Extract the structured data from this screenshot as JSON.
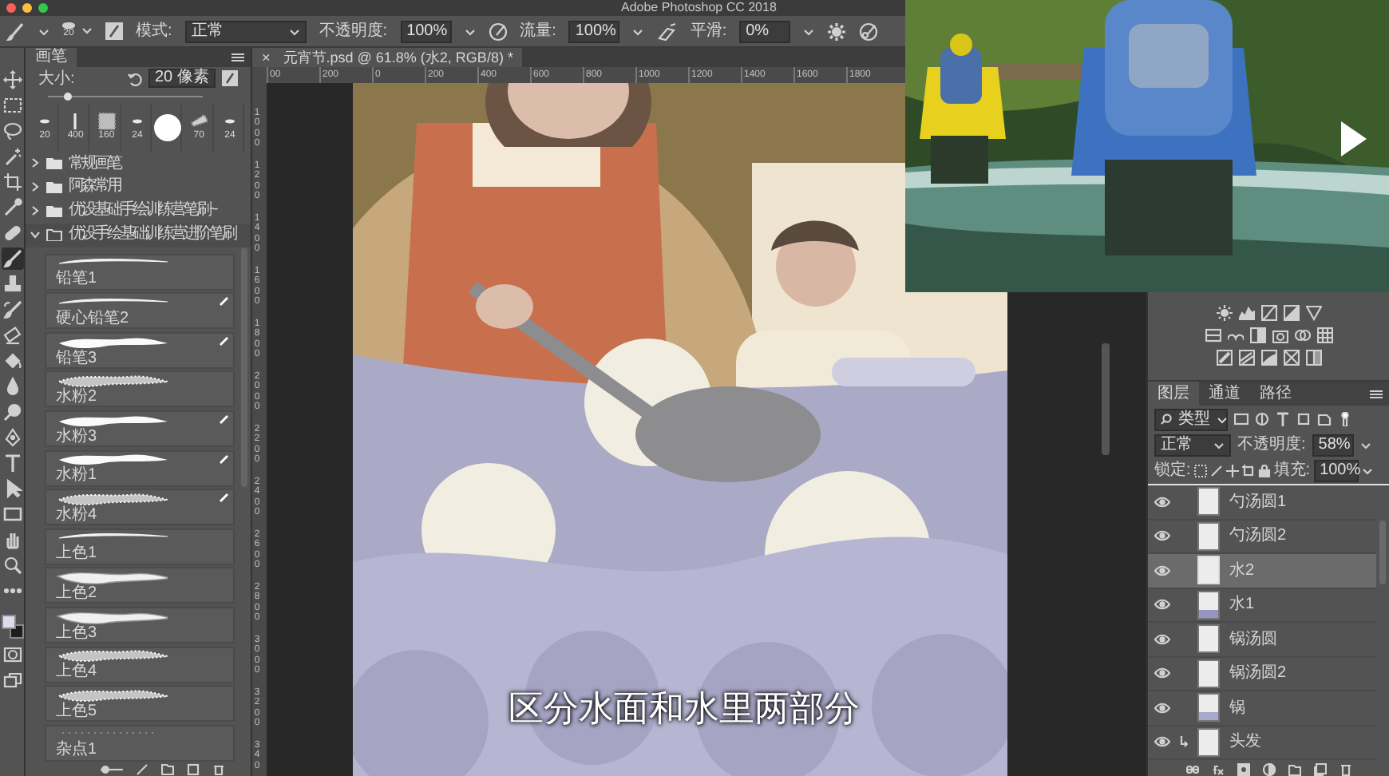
{
  "app": {
    "title": "Adobe Photoshop CC 2018"
  },
  "options_bar": {
    "brush_size": "20",
    "mode_label": "模式:",
    "mode": "正常",
    "opacity_label": "不透明度:",
    "opacity": "100%",
    "flow_label": "流量:",
    "flow": "100%",
    "smoothing_label": "平滑:",
    "smoothing": "0%"
  },
  "tools": [
    {
      "kind": "move",
      "selected": false
    },
    {
      "kind": "marquee",
      "selected": false
    },
    {
      "kind": "lasso",
      "selected": false
    },
    {
      "kind": "wand",
      "selected": false
    },
    {
      "kind": "crop",
      "selected": false
    },
    {
      "kind": "eyedropper",
      "selected": false
    },
    {
      "kind": "healing",
      "selected": false
    },
    {
      "kind": "brush",
      "selected": true
    },
    {
      "kind": "stamp",
      "selected": false
    },
    {
      "kind": "history",
      "selected": false
    },
    {
      "kind": "eraser",
      "selected": false
    },
    {
      "kind": "bucket",
      "selected": false
    },
    {
      "kind": "blur",
      "selected": false
    },
    {
      "kind": "dodge",
      "selected": false
    },
    {
      "kind": "pen",
      "selected": false
    },
    {
      "kind": "type",
      "selected": false
    },
    {
      "kind": "pointer",
      "selected": false
    },
    {
      "kind": "rectangle",
      "selected": false
    },
    {
      "kind": "hand",
      "selected": false
    },
    {
      "kind": "zoom",
      "selected": false
    },
    {
      "kind": "more",
      "selected": false
    }
  ],
  "color_swatches": [
    {
      "kind": "foreground",
      "color": "#dcdcec"
    },
    {
      "kind": "background",
      "color": "#1e1e1e"
    }
  ],
  "brush_panel": {
    "tab": "画笔",
    "size_label": "大小:",
    "size": "20 像素",
    "level": 0.12,
    "presets": [
      {
        "kind": "stroke",
        "label": "20"
      },
      {
        "kind": "line",
        "label": "400"
      },
      {
        "kind": "texture",
        "label": "160"
      },
      {
        "kind": "stroke",
        "label": "24"
      },
      {
        "kind": "round"
      },
      {
        "kind": "scatter",
        "label": "70"
      },
      {
        "kind": "stroke",
        "label": "24"
      }
    ],
    "folders": [
      {
        "name": "常规画笔",
        "expanded": false
      },
      {
        "name": "阿森常用",
        "expanded": false
      },
      {
        "name": "优设基础手绘训练营笔刷~",
        "expanded": false
      },
      {
        "name": "优设手绘基础训练营进阶笔刷",
        "expanded": true
      }
    ],
    "brushes": [
      {
        "name": "铅笔1",
        "kind": "pencil",
        "modified": false
      },
      {
        "name": "硬心铅笔2",
        "kind": "pencil",
        "modified": true
      },
      {
        "name": "铅笔3",
        "kind": "thick",
        "modified": true
      },
      {
        "name": "水粉2",
        "kind": "texture",
        "modified": false
      },
      {
        "name": "水粉3",
        "kind": "thick",
        "modified": true
      },
      {
        "name": "水粉1",
        "kind": "thick",
        "modified": true
      },
      {
        "name": "水粉4",
        "kind": "texture",
        "modified": true
      },
      {
        "name": "上色1",
        "kind": "pencil",
        "modified": false
      },
      {
        "name": "上色2",
        "kind": "soft",
        "modified": false
      },
      {
        "name": "上色3",
        "kind": "soft",
        "modified": false
      },
      {
        "name": "上色4",
        "kind": "texture",
        "modified": false
      },
      {
        "name": "上色5",
        "kind": "texture",
        "modified": false
      },
      {
        "name": "杂点1",
        "kind": "speckle",
        "modified": false
      }
    ]
  },
  "document_tab": {
    "close": "×",
    "title": "元宵节.psd @ 61.8% (水2, RGB/8) *"
  },
  "rulers": {
    "horizontal": [
      "00",
      "200",
      "0",
      "200",
      "400",
      "600",
      "800",
      "1000",
      "1200",
      "1400",
      "1600",
      "1800"
    ],
    "vertical": [
      "1000",
      "1200",
      "1400",
      "1600",
      "1800",
      "2000",
      "2200",
      "2400",
      "2600",
      "2800",
      "3000",
      "3200",
      "340"
    ]
  },
  "subtitle": "区分水面和水里两部分",
  "layers_panel": {
    "tabs": [
      {
        "label": "图层",
        "selected": true
      },
      {
        "label": "通道",
        "selected": false
      },
      {
        "label": "路径",
        "selected": false
      }
    ],
    "filter": "类型",
    "blend_mode": "正常",
    "opacity_label": "不透明度:",
    "opacity": "58%",
    "lock_label": "锁定:",
    "fill_label": "填充:",
    "fill": "100%",
    "layers": [
      {
        "name": "勺汤圆1",
        "visible": true,
        "selected": false,
        "clipped": false
      },
      {
        "name": "勺汤圆2",
        "visible": true,
        "selected": false,
        "clipped": false
      },
      {
        "name": "水2",
        "visible": true,
        "selected": true,
        "clipped": false
      },
      {
        "name": "水1",
        "visible": true,
        "selected": false,
        "clipped": false,
        "color": "#9794c2"
      },
      {
        "name": "锅汤圆",
        "visible": true,
        "selected": false,
        "clipped": false
      },
      {
        "name": "锅汤圆2",
        "visible": true,
        "selected": false,
        "clipped": false
      },
      {
        "name": "锅",
        "visible": true,
        "selected": false,
        "clipped": false,
        "color": "#a9a7cc"
      },
      {
        "name": "头发",
        "visible": true,
        "selected": false,
        "clipped": true
      }
    ]
  }
}
